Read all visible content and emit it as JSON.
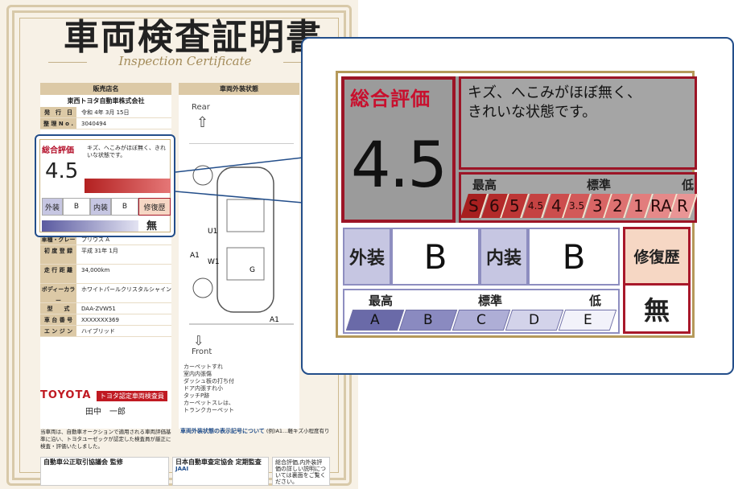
{
  "certificate": {
    "title": "車両検査証明書",
    "subtitle": "Inspection Certificate",
    "dealer_header": "販売店名",
    "dealer_name": "東西トヨタ自動車株式会社",
    "issue_date_label": "発　行　日",
    "issue_date": "令和 4年 3月 15日",
    "serial_label": "整 理 N o .",
    "serial": "3040494",
    "grade_label": "車種・グレード",
    "grade": "プリウス A",
    "first_reg_label": "初 度 登 録",
    "first_reg": "平成 31年 1月",
    "mileage_label": "走 行 距 離",
    "mileage": "34,000km",
    "color_label": "ボディーカラー",
    "color": "ホワイトパールクリスタルシャイン",
    "model_label": "型　　式",
    "model": "DAA-ZVW51",
    "chassis_label": "車 台 番 号",
    "chassis": "XXXXXXX369",
    "engine_label": "エ ン ジ ン",
    "engine": "ハイブリッド",
    "brand": "TOYOTA",
    "badge": "トヨタ認定車両検査員",
    "inspector": "田中　一郎",
    "note": "当車両は、自動車オークションで適用される車両評価基準に沿い、トヨタユーゼックが認定した検査員が厳正に検査・評価いたしました。",
    "exterior_header": "車両外装状態",
    "rear": "Rear",
    "front": "Front",
    "remarks": "カーペットすれ\n室内内張傷\nダッシュ板の打ち付\nドア内張すれ小\nタッチP跡\nカーペットスレは、\nトランクカーペット",
    "legend_title": "車両外装状態の表示記号について",
    "legend_sub": "(例)A1…軽キズ小程度有り",
    "footer1": "自動車公正取引協議会 監修",
    "footer2": "日本自動車査定協会 定期監査",
    "footer3": "総合評価,内外装評価の詳しい説明については裏面をご覧ください。",
    "jaai": "JAAI",
    "car_labels": [
      "U1",
      "A1",
      "W1",
      "G",
      "A1"
    ],
    "mini": {
      "score_label": "総合評価",
      "score": "4.5",
      "comment": "キズ、へこみがほぼ無く、きれいな状態です。",
      "ext": "外装",
      "ext_grade": "B",
      "int": "内装",
      "int_grade": "B",
      "repair": "修復歴",
      "repair_value": "無"
    }
  },
  "zoom": {
    "score_label": "総合評価",
    "score": "4.5",
    "comment": "キズ、へこみがほぼ無く、\nきれいな状態です。",
    "scale_high": "最高",
    "scale_std": "標準",
    "scale_low": "低",
    "scale": [
      "S",
      "6",
      "5",
      "4.5",
      "4",
      "3.5",
      "3",
      "2",
      "1",
      "RA",
      "R"
    ],
    "scale_colors": [
      "#a71f1f",
      "#b32a2a",
      "#bd3636",
      "#c54242",
      "#cc4d4d",
      "#d25959",
      "#d86565",
      "#dd7171",
      "#e27d7d",
      "#e58989",
      "#e99595"
    ],
    "ext_label": "外装",
    "ext_grade": "B",
    "int_label": "内装",
    "int_grade": "B",
    "repair_label": "修復歴",
    "repair_value": "無",
    "qscale_high": "最高",
    "qscale_std": "標準",
    "qscale_low": "低",
    "qscale": [
      "A",
      "B",
      "C",
      "D",
      "E"
    ],
    "qscale_colors": [
      "#6a6aa8",
      "#8a8ac0",
      "#aeaed6",
      "#d3d3ea",
      "#f2f2fa"
    ]
  }
}
